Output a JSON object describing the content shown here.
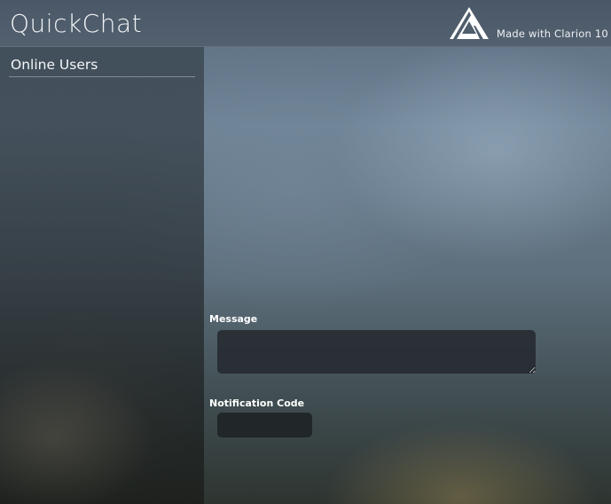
{
  "header": {
    "title": "QuickChat",
    "made_with": "Made with Clarion 10",
    "logo_icon": "clarion-triangle-logo-icon"
  },
  "sidebar": {
    "title": "Online Users",
    "users": []
  },
  "form": {
    "message_label": "Message",
    "message_value": "",
    "code_label": "Notification Code",
    "code_value": ""
  },
  "colors": {
    "header_bg": "#4d5b6a",
    "input_bg": "#23282e",
    "text": "#ffffff"
  }
}
